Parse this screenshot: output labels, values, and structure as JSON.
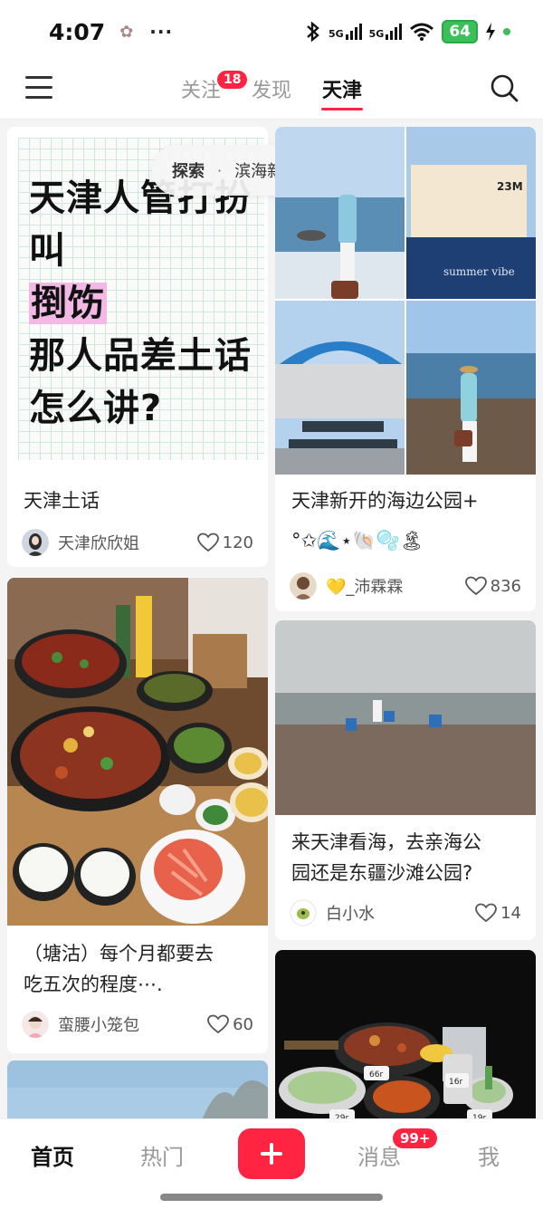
{
  "status_bar": {
    "time": "4:07",
    "more": "···",
    "net1": "5G",
    "net2": "5G",
    "battery": "64"
  },
  "top_nav": {
    "tabs": [
      {
        "label": "关注"
      },
      {
        "label": "发现"
      },
      {
        "label": "天津"
      }
    ],
    "follow_badge": "18",
    "active_tab": "天津"
  },
  "explore": {
    "label": "探索",
    "separator": "·",
    "location": "滨海新区",
    "arrow": "»"
  },
  "cards": [
    {
      "cover_lines": [
        "天津人管打扮",
        "叫",
        "捯饬",
        "那人品差土话",
        "怎么讲?"
      ],
      "title": "天津土话",
      "author": "天津欣欣姐",
      "likes": "120"
    },
    {
      "cover_caption": "summer vibe",
      "cover_sign": "23M",
      "title_line1": "天津新开的海边公园+",
      "title_line2": "°✩🌊⋆🐚🫧🏝",
      "author": "💛_沛霖霖",
      "likes": "836"
    },
    {
      "title_line1": "（塘沽）每个月都要去",
      "title_line2": "吃五次的程度⋯.",
      "author": "蛮腰小笼包",
      "likes": "60"
    },
    {
      "title_line1": "来天津看海，去亲海公",
      "title_line2": "园还是东疆沙滩公园?",
      "author": "白小水",
      "likes": "14"
    },
    {
      "tags": [
        "66r",
        "16r",
        "29r",
        "19r"
      ]
    }
  ],
  "bottom_nav": {
    "items": [
      {
        "label": "首页"
      },
      {
        "label": "热门"
      },
      {
        "label": "消息"
      },
      {
        "label": "我"
      }
    ],
    "message_badge": "99+"
  },
  "colors": {
    "accent": "#ff2442",
    "background": "#f4f4f4"
  }
}
